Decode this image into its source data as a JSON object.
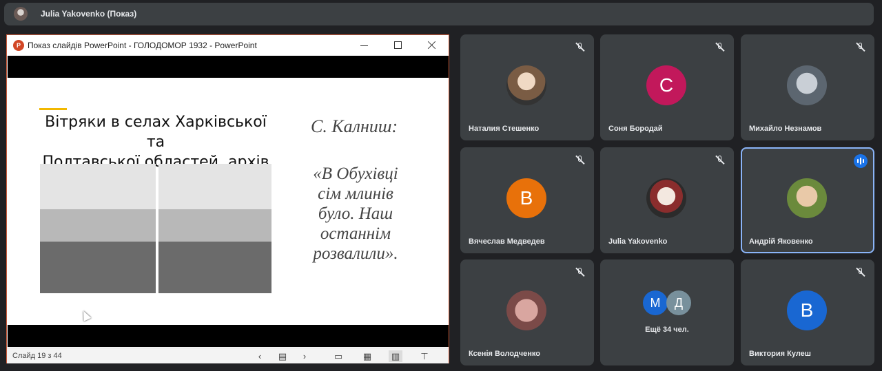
{
  "presenter_bar": {
    "name": "Julia Yakovenko (Показ)"
  },
  "ppt_window": {
    "title": "Показ слайдів PowerPoint  -  ГОЛОДОМОР 1932  -  PowerPoint",
    "slide": {
      "heading_line1": "Вітряки в селах Харківської та",
      "heading_line2": "Полтавської областей, архів",
      "quote_author": "С. Калниш:",
      "quote_lines": [
        "«В Обухівці",
        "сім млинів",
        "було. Наш",
        "останнім",
        "розвалили»."
      ]
    },
    "status": {
      "slide_counter": "Слайд 19 з 44"
    }
  },
  "participants": [
    {
      "name": "Наталия Стешенко",
      "initial": "",
      "color": "",
      "muted": true
    },
    {
      "name": "Соня Бородай",
      "initial": "С",
      "color": "#c2185b",
      "muted": true
    },
    {
      "name": "Михайло Незнамов",
      "initial": "",
      "color": "",
      "muted": true
    },
    {
      "name": "Вячеслав Медведев",
      "initial": "В",
      "color": "#e8710a",
      "muted": true
    },
    {
      "name": "Julia Yakovenko",
      "initial": "",
      "color": "",
      "muted": true
    },
    {
      "name": "Андрій Яковенко",
      "initial": "",
      "color": "",
      "muted": false,
      "speaking": true
    },
    {
      "name": "Ксенія Володченко",
      "initial": "",
      "color": "",
      "muted": true
    },
    {
      "name": "",
      "initial": "",
      "color": "",
      "muted": false
    },
    {
      "name": "Виктория Кулеш",
      "initial": "В",
      "color": "#1967d2",
      "muted": true
    }
  ],
  "more_tile": {
    "avatars": [
      {
        "initial": "М",
        "color": "#1967d2"
      },
      {
        "initial": "Д",
        "color": "#78909c"
      }
    ],
    "text": "Ещё 34 чел."
  }
}
